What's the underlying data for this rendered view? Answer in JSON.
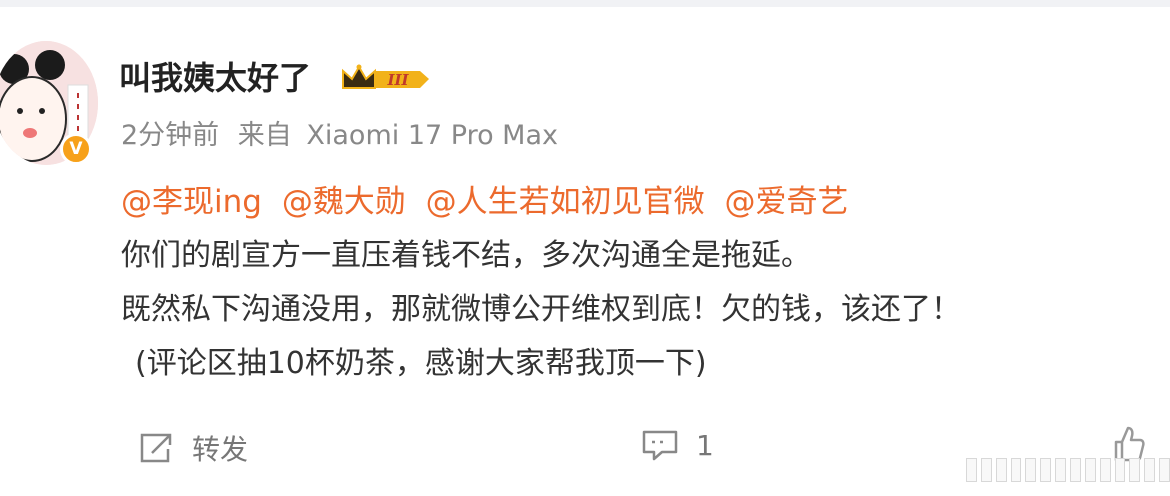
{
  "post": {
    "username": "叫我姨太好了",
    "member_badge": "III",
    "time_ago": "2分钟前",
    "source_prefix": "来自",
    "source_device": "Xiaomi 17 Pro Max",
    "mentions": [
      "@李现ing",
      "@魏大勋",
      "@人生若如初见官微",
      "@爱奇艺"
    ],
    "body_lines": [
      "你们的剧宣方一直压着钱不结，多次沟通全是拖延。",
      "既然私下沟通没用，那就微博公开维权到底！欠的钱，该还了！",
      "(评论区抽10杯奶茶，感谢大家帮我顶一下)"
    ]
  },
  "actions": {
    "repost_label": "转发",
    "comment_count": "1"
  },
  "colors": {
    "mention": "#ec6a2d",
    "verified_badge": "#f7a11a",
    "member_badge": "#f2b21a"
  }
}
